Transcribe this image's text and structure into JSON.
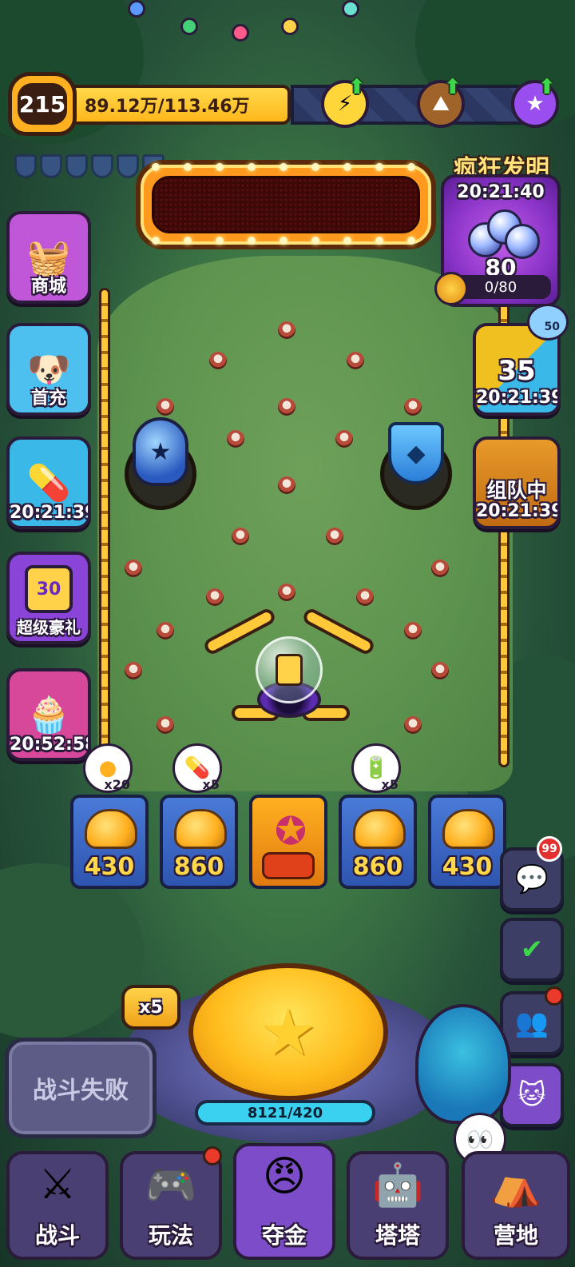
{
  "player": {
    "level": "215",
    "resource": "89.12万/113.46万"
  },
  "top_upgrades": [
    {
      "icon": "lightning-icon",
      "color": "#ffd63a"
    },
    {
      "icon": "mountain-icon",
      "color": "#a0642a"
    },
    {
      "icon": "star-icon",
      "color": "#9b4ef0"
    }
  ],
  "left_menu": [
    {
      "label": "商城",
      "icon": "shop-basket-icon",
      "bg": "#c056d8"
    },
    {
      "label": "首充",
      "icon": "dog-mascot-icon",
      "bg": "#4ec0f0"
    },
    {
      "label": "20:21:39",
      "icon": "capsule-icon",
      "bg": "#3ab8e8"
    },
    {
      "label": "超级豪礼",
      "icon": "gift-30-icon",
      "bg": "#8a44d8",
      "inner": "30"
    },
    {
      "label": "20:52:58",
      "icon": "cake-icon",
      "bg": "#d8489a"
    }
  ],
  "crazy_invention": {
    "title": "疯狂发明",
    "timer": "20:21:40",
    "count": "80",
    "progress": "0/80"
  },
  "right_menu": [
    {
      "value": "35",
      "label": "20:21:39",
      "badge": "50",
      "bg": "#f0c020"
    },
    {
      "value": "组队中",
      "label": "20:21:39",
      "bg": "#e89a2a"
    }
  ],
  "bins": [
    {
      "value": "430",
      "reward": "x20",
      "reward_icon": "coin-icon"
    },
    {
      "value": "860",
      "reward": "x5",
      "reward_icon": "capsule-icon"
    },
    {
      "value": "",
      "reward": "",
      "reward_icon": "mystery-star-icon"
    },
    {
      "value": "860",
      "reward": "x5",
      "reward_icon": "battery-icon"
    },
    {
      "value": "430",
      "reward": "",
      "reward_icon": ""
    }
  ],
  "utility": {
    "chat_badge": "99"
  },
  "launcher": {
    "multiplier": "x5",
    "energy": "8121/420",
    "battle_status": "战斗失败"
  },
  "nav": [
    {
      "label": "战斗",
      "icon": "swords-icon",
      "dot": false
    },
    {
      "label": "玩法",
      "icon": "gamepad-icon",
      "dot": true
    },
    {
      "label": "夺金",
      "icon": "faces-star-icon",
      "dot": false,
      "active": true
    },
    {
      "label": "塔塔",
      "icon": "cat-robot-icon",
      "dot": false
    },
    {
      "label": "营地",
      "icon": "tent-icon",
      "dot": false
    }
  ]
}
